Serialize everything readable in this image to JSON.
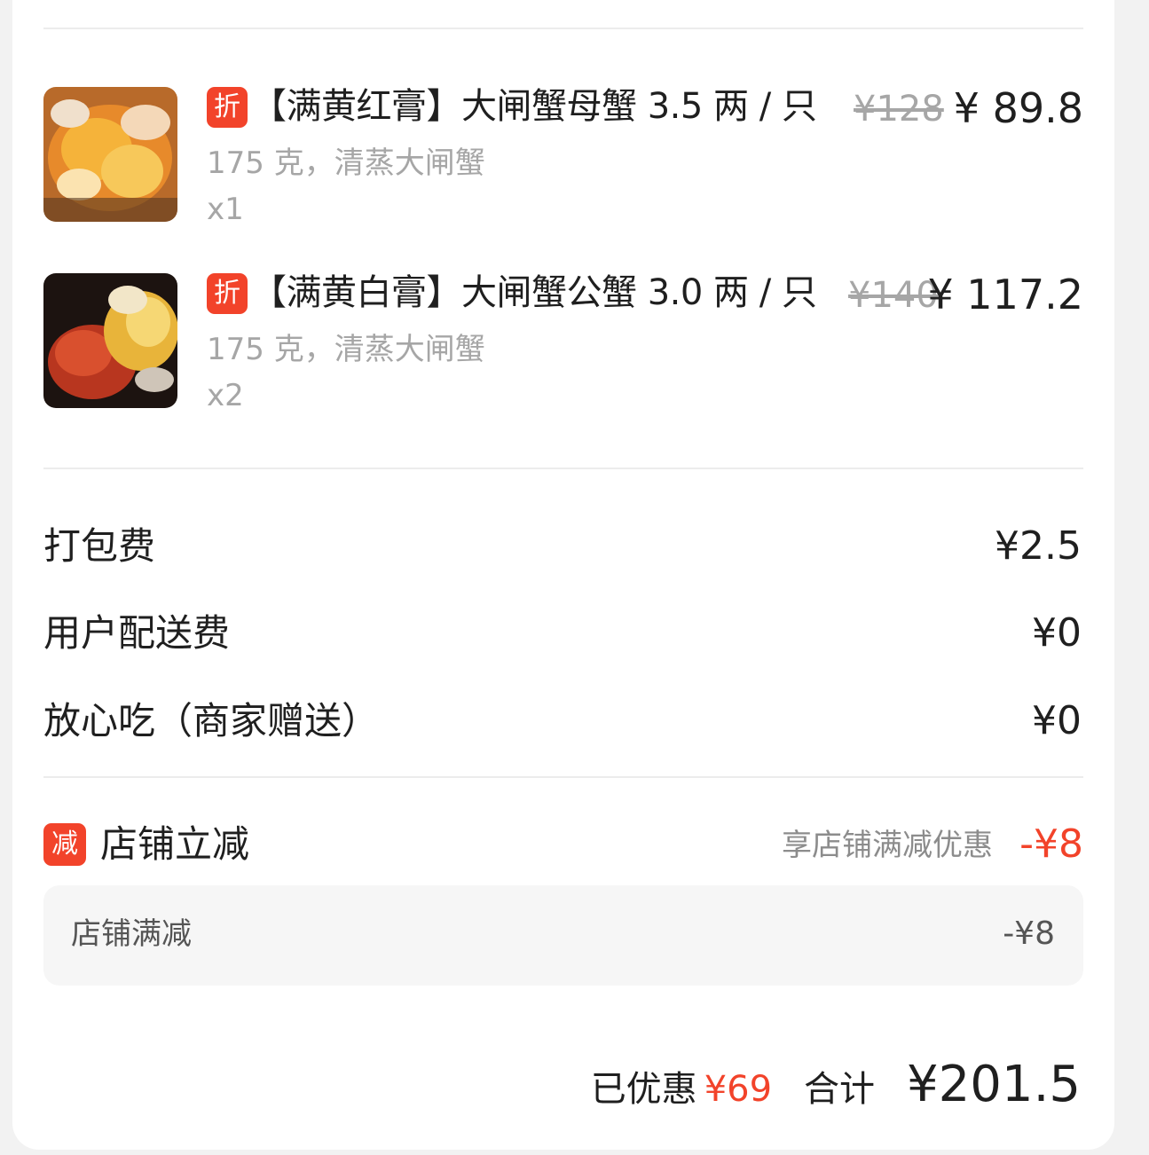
{
  "items": [
    {
      "tag": "折",
      "title": "【满黄红膏】大闸蟹母蟹 3.5 两 / 只",
      "spec": "175 克，清蒸大闸蟹",
      "qty": "x1",
      "price_original": "¥128",
      "price_current": "¥ 89.8",
      "image": "crab-photo"
    },
    {
      "tag": "折",
      "title": "【满黄白膏】大闸蟹公蟹 3.0 两 / 只",
      "spec": "175 克，清蒸大闸蟹",
      "qty": "x2",
      "price_original": "¥140",
      "price_current": "¥ 117.2",
      "image": "crab-photo"
    }
  ],
  "fees": [
    {
      "label": "打包费",
      "value": "¥2.5"
    },
    {
      "label": "用户配送费",
      "value": "¥0"
    },
    {
      "label": "放心吃（商家赠送）",
      "value": "¥0"
    }
  ],
  "promotion": {
    "icon": "减",
    "label": "店铺立减",
    "description": "享店铺满减优惠",
    "amount": "-¥8",
    "detail_label": "店铺满减",
    "detail_amount": "-¥8"
  },
  "summary": {
    "saved_label": "已优惠",
    "saved_amount": "¥69",
    "total_label": "合计",
    "total_amount": "¥201.5"
  },
  "colors": {
    "accent": "#f2432a",
    "muted_text": "#a6a6a6",
    "card_bg": "#ffffff",
    "page_bg": "#f2f2f2"
  }
}
